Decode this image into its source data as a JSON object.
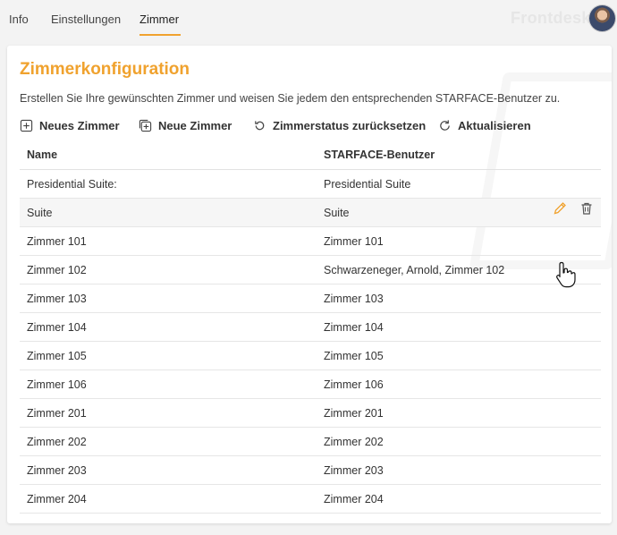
{
  "tabs": [
    {
      "label": "Info"
    },
    {
      "label": "Einstellungen"
    },
    {
      "label": "Zimmer"
    }
  ],
  "brand": "Frontdesk",
  "page": {
    "title": "Zimmerkonfiguration",
    "description": "Erstellen Sie Ihre gewünschten Zimmer und weisen Sie jedem den entsprechenden STARFACE-Benutzer zu."
  },
  "toolbar": {
    "new_room": "Neues Zimmer",
    "new_room2": "Neue Zimmer",
    "reset_status": "Zimmerstatus zurücksetzen",
    "refresh": "Aktualisieren"
  },
  "table": {
    "headers": [
      "Name",
      "STARFACE-Benutzer"
    ],
    "rows": [
      [
        "Presidential Suite:",
        "Presidential Suite"
      ],
      [
        "Suite",
        "Suite"
      ],
      [
        "Zimmer 101",
        "Zimmer 101"
      ],
      [
        "Zimmer 102",
        "Schwarzeneger, Arnold, Zimmer 102"
      ],
      [
        "Zimmer 103",
        "Zimmer 103"
      ],
      [
        "Zimmer 104",
        "Zimmer 104"
      ],
      [
        "Zimmer 105",
        "Zimmer 105"
      ],
      [
        "Zimmer 106",
        "Zimmer 106"
      ],
      [
        "Zimmer 201",
        "Zimmer 201"
      ],
      [
        "Zimmer 202",
        "Zimmer 202"
      ],
      [
        "Zimmer 203",
        "Zimmer 203"
      ],
      [
        "Zimmer 204",
        "Zimmer 204"
      ]
    ]
  },
  "colors": {
    "accent": "#f0a22e"
  }
}
